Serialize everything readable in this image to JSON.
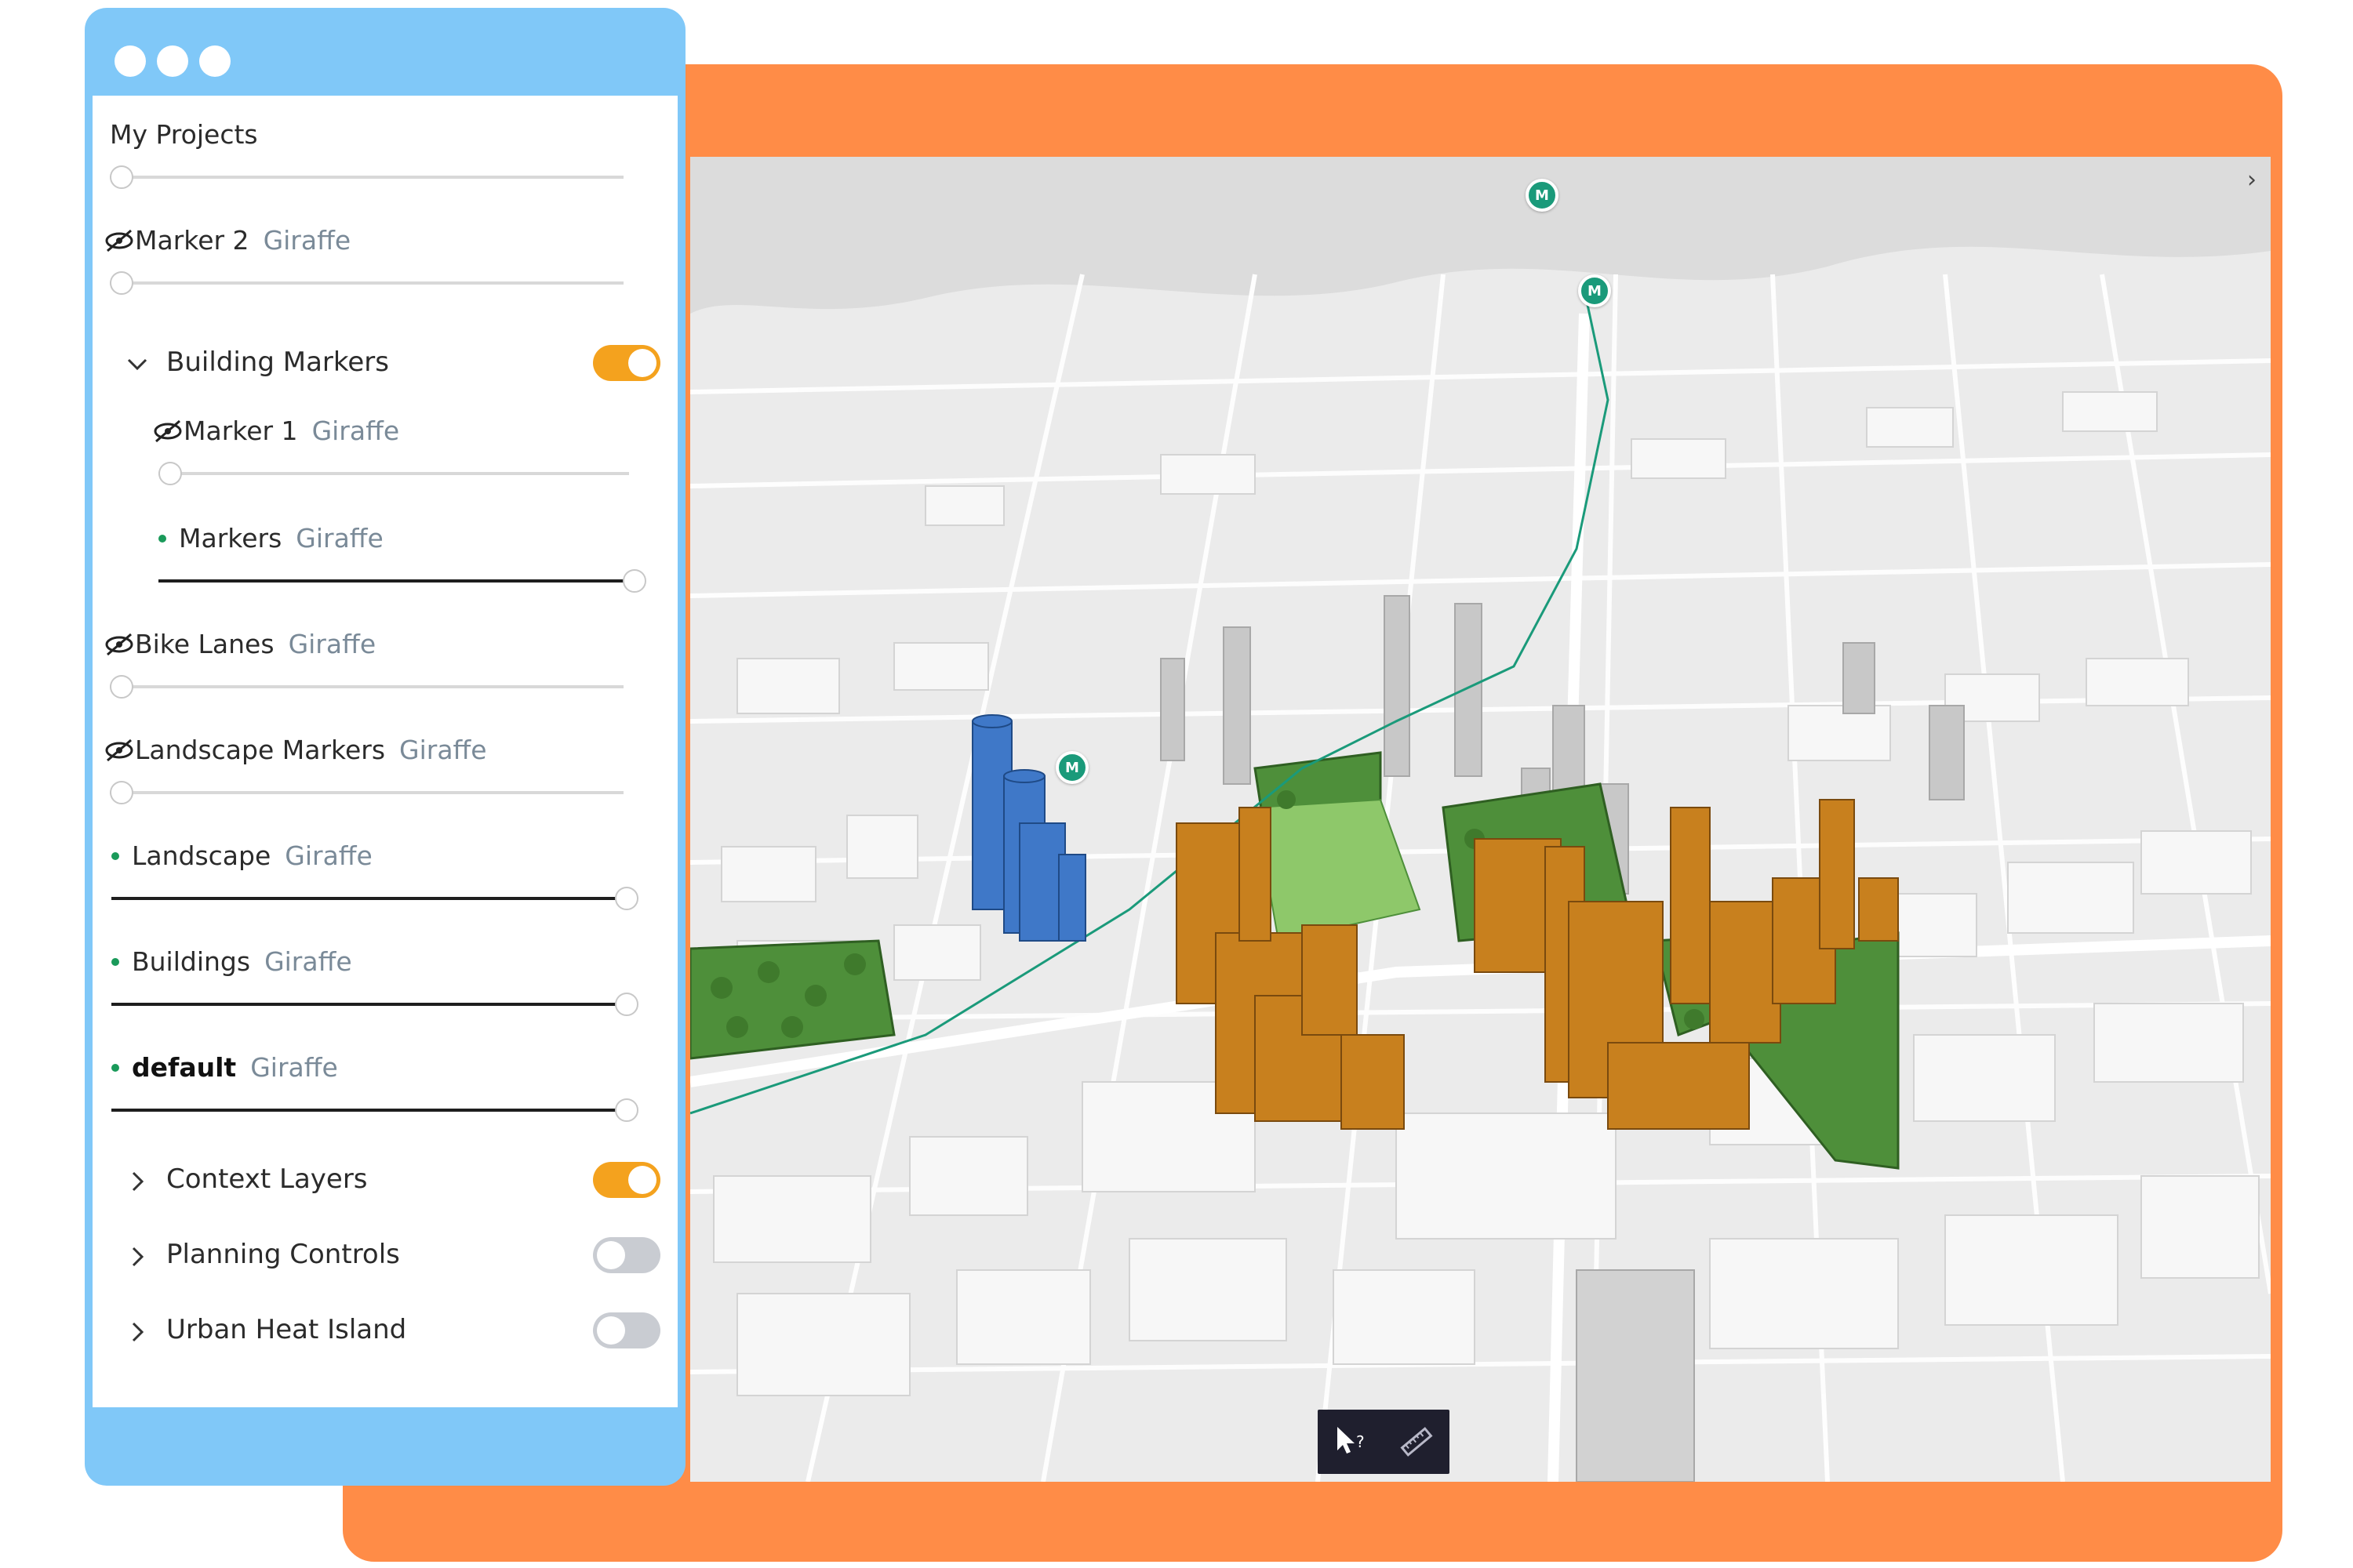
{
  "window": {
    "controls": [
      "close",
      "minimize",
      "maximize"
    ]
  },
  "layers_panel": {
    "title": "My Projects",
    "items": [
      {
        "name": "Marker 2",
        "source": "Giraffe",
        "visible": false,
        "opacity": 0
      },
      {
        "group": "Building Markers",
        "expanded": true,
        "toggle": true,
        "children": [
          {
            "name": "Marker 1",
            "source": "Giraffe",
            "visible": false,
            "opacity": 0
          },
          {
            "name": "Markers",
            "source": "Giraffe",
            "visible": true,
            "opacity": 1
          }
        ]
      },
      {
        "name": "Bike Lanes",
        "source": "Giraffe",
        "visible": false,
        "opacity": 0
      },
      {
        "name": "Landscape Markers",
        "source": "Giraffe",
        "visible": false,
        "opacity": 0
      },
      {
        "name": "Landscape",
        "source": "Giraffe",
        "visible": true,
        "opacity": 1
      },
      {
        "name": "Buildings",
        "source": "Giraffe",
        "visible": true,
        "opacity": 1
      },
      {
        "name": "default",
        "source": "Giraffe",
        "visible": true,
        "opacity": 1,
        "bold": true
      }
    ],
    "groups": [
      {
        "label": "Context Layers",
        "expanded": false,
        "toggle": true
      },
      {
        "label": "Planning Controls",
        "expanded": false,
        "toggle": false
      },
      {
        "label": "Urban Heat Island",
        "expanded": false,
        "toggle": false
      }
    ]
  },
  "map": {
    "collapse_glyph": "›",
    "metro_label": "M",
    "toolbar": [
      {
        "icon": "cursor-question-icon"
      },
      {
        "icon": "ruler-icon"
      }
    ],
    "colors": {
      "proposed_buildings": "#c8801e",
      "highlighted_buildings": "#3f78c8",
      "parks": "#4e8f3a",
      "context_buildings": "#ffffff",
      "ground": "#ebebeb"
    }
  },
  "colors": {
    "frame_orange": "#ff8c47",
    "window_blue": "#80c8f8",
    "toggle_on": "#f4a21e",
    "toggle_off": "#c9ccd2",
    "visible_dot": "#1a9a5a"
  }
}
